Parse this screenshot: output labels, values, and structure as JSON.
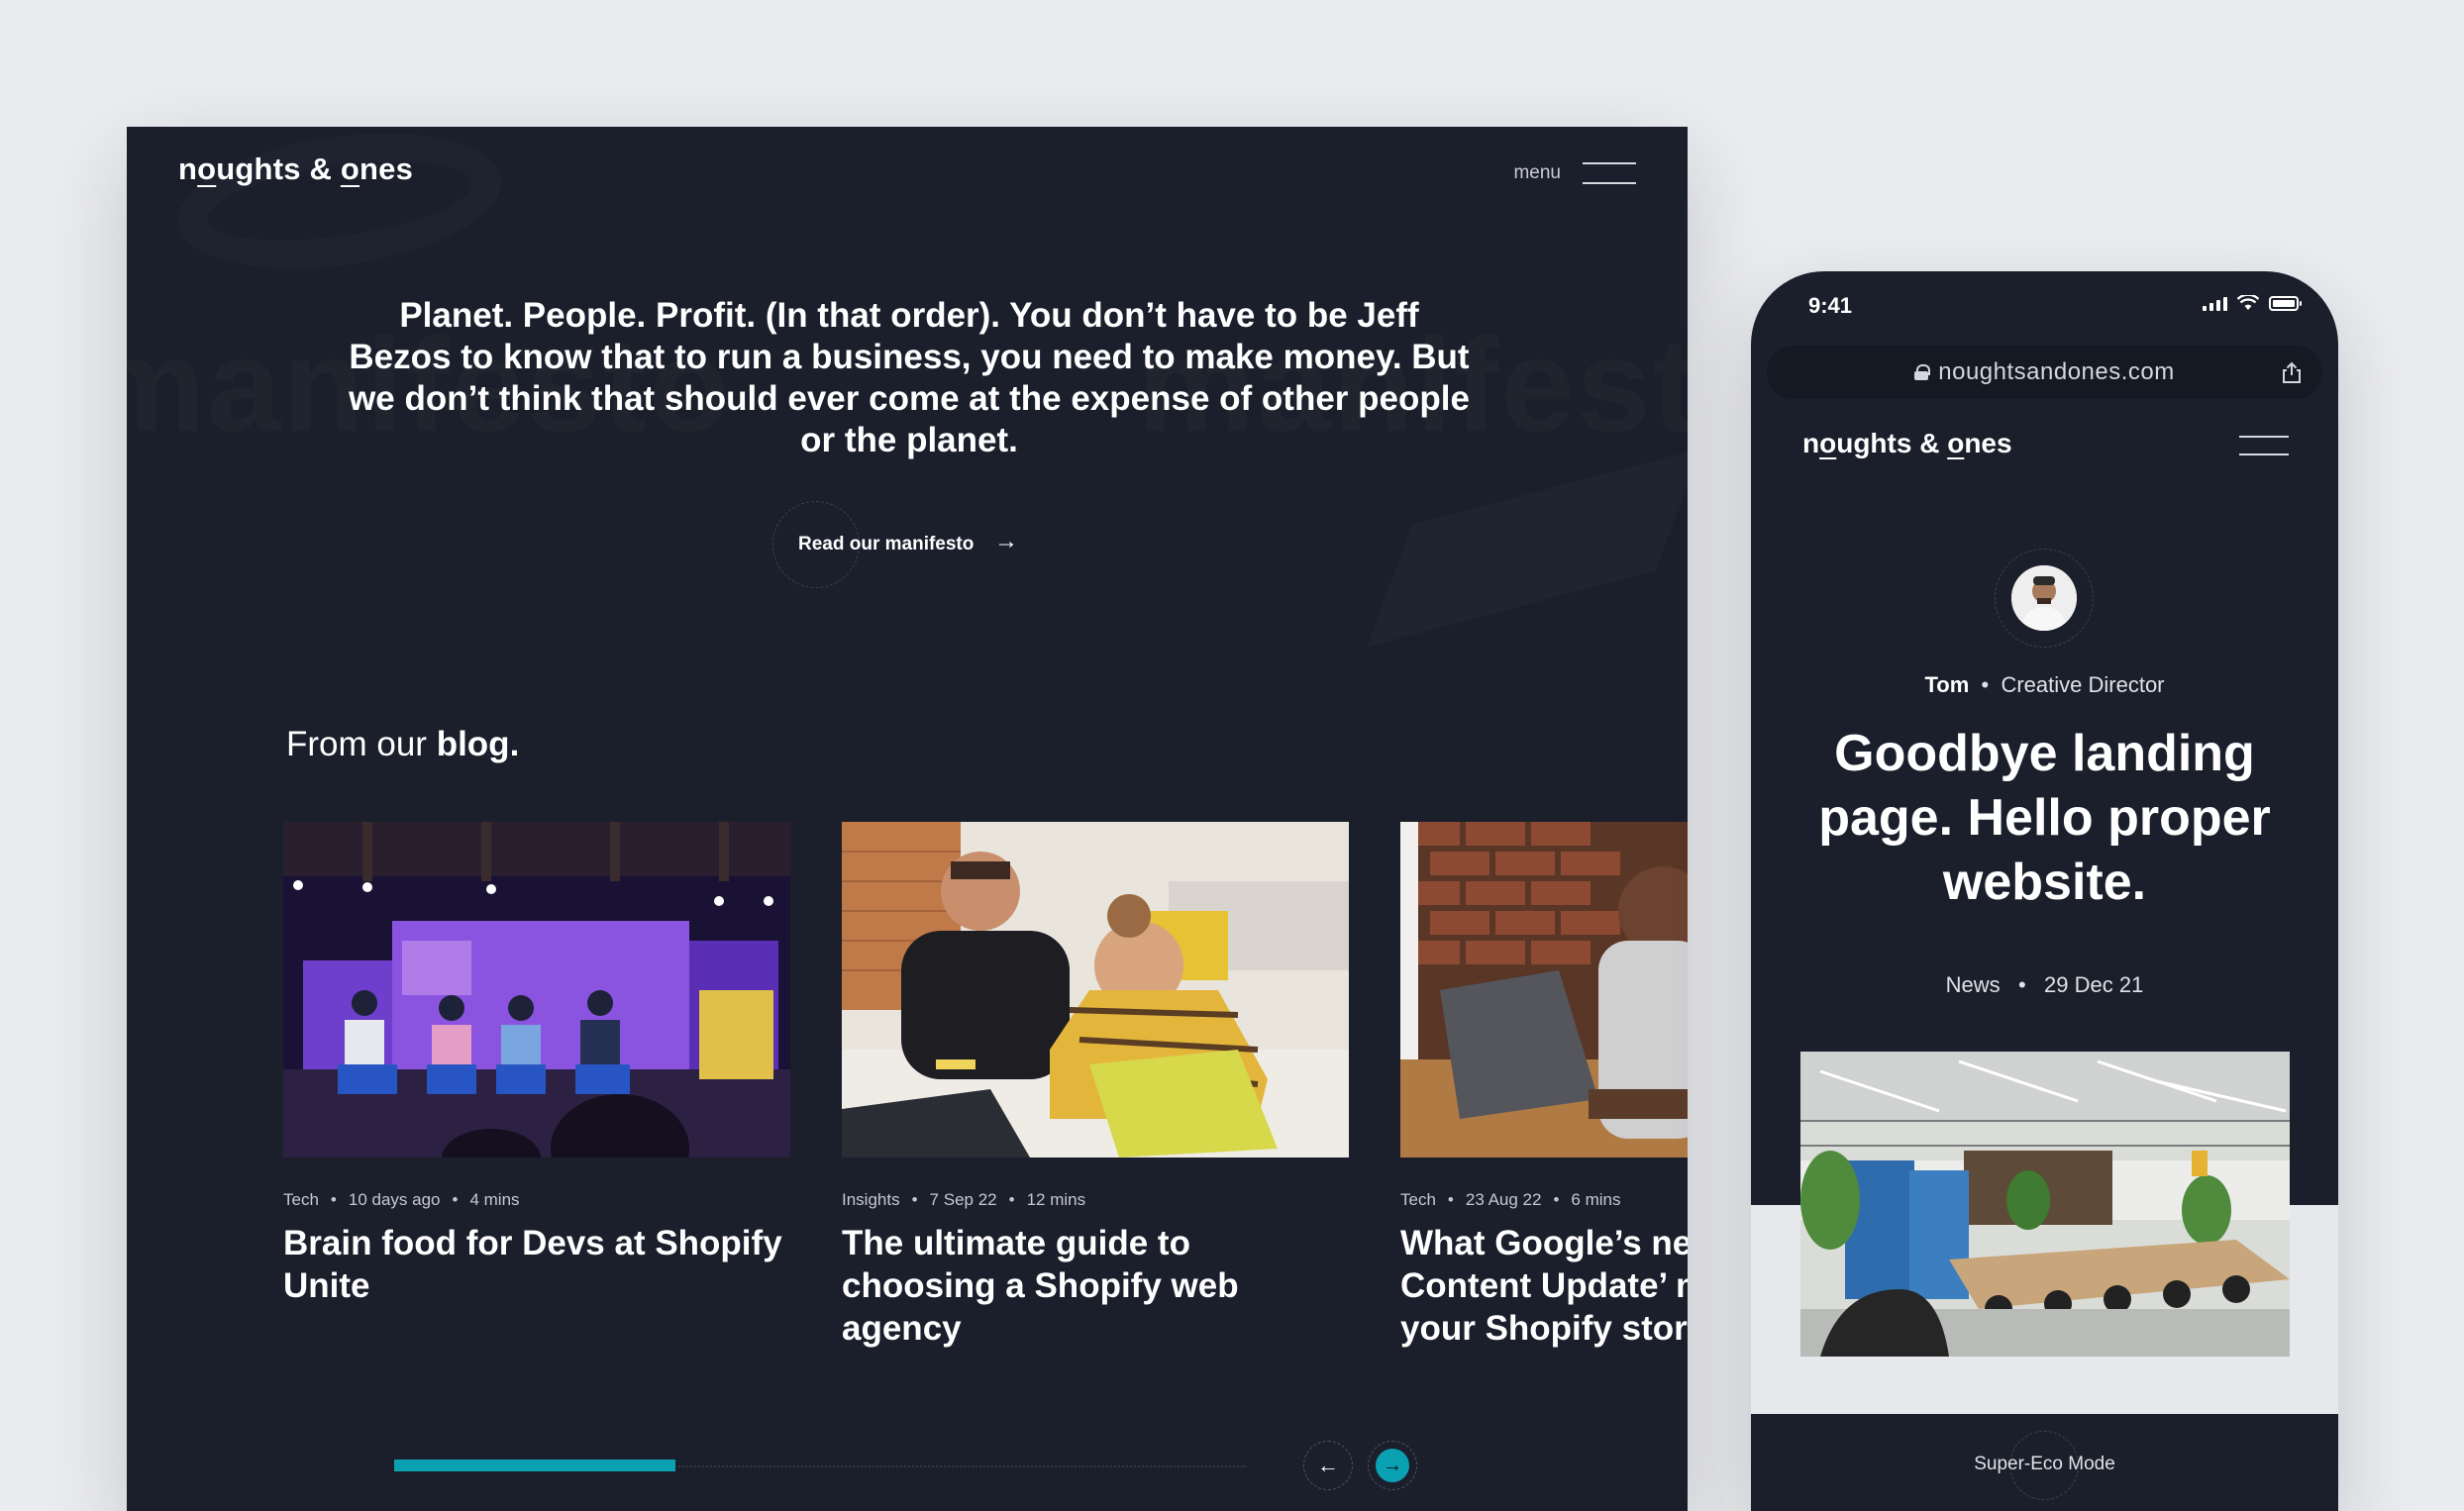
{
  "desktop": {
    "logo": {
      "pre": "n",
      "u1": "o",
      "mid": "ughts & ",
      "u2": "o",
      "post": "nes"
    },
    "menu_label": "menu",
    "background_words": [
      "manifesto",
      "manifesto"
    ],
    "hero_text": "Planet. People. Profit. (In that order). You don’t have to be Jeff Bezos to know that to run a business, you need to make money. But we don’t think that should ever come at the expense of other people or the planet.",
    "manifesto_label": "Read our manifesto",
    "manifesto_arrow": "→",
    "blog_heading_pre": "From our ",
    "blog_heading_bold": "blog.",
    "cards": [
      {
        "category": "Tech",
        "date": "10 days ago",
        "duration": "4 mins",
        "title_l1": "Brain food for Devs at Shopify",
        "title_l2": "Unite",
        "title_l3": ""
      },
      {
        "category": "Insights",
        "date": "7 Sep 22",
        "duration": "12 mins",
        "title_l1": "The ultimate guide to",
        "title_l2": "choosing a Shopify web",
        "title_l3": "agency"
      },
      {
        "category": "Tech",
        "date": "23 Aug 22",
        "duration": "6 mins",
        "title_l1": "What Google’s new",
        "title_l2": "Content Update’ m",
        "title_l3": "your Shopify store"
      }
    ],
    "meta_sep": "•",
    "prev_arrow": "←",
    "next_arrow": "→",
    "progress_fraction": 0.33,
    "accent_color": "#0aa1b3"
  },
  "phone": {
    "time": "9:41",
    "url": "noughtsandones.com",
    "logo": {
      "pre": "n",
      "u1": "o",
      "mid": "ughts & ",
      "u2": "o",
      "post": "nes"
    },
    "author_name": "Tom",
    "author_sep": "•",
    "author_role": "Creative Director",
    "title": "Goodbye landing page. Hello proper website.",
    "meta_category": "News",
    "meta_sep": "•",
    "meta_date": "29 Dec 21",
    "eco_mode": "Super-Eco Mode"
  },
  "icons": [
    "hamburger-icon",
    "arrow-right-icon",
    "arrow-left-icon",
    "lock-icon",
    "share-icon",
    "signal-icon",
    "wifi-icon",
    "battery-icon"
  ]
}
